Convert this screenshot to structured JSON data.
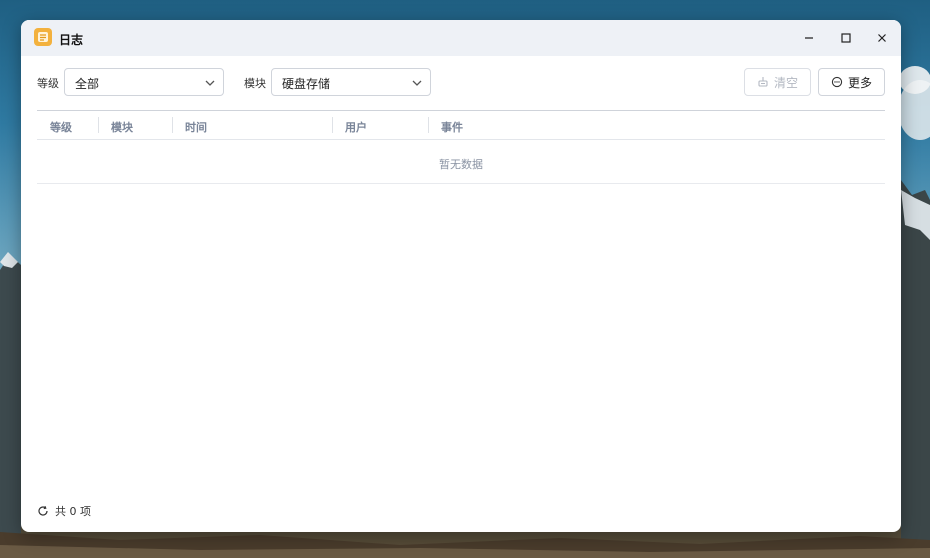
{
  "window": {
    "title": "日志",
    "controls": [
      "minimize-icon",
      "maximize-icon",
      "close-icon"
    ]
  },
  "filters": {
    "level_label": "等级",
    "level_value": "全部",
    "module_label": "模块",
    "module_value": "硬盘存储"
  },
  "actions": {
    "clear_label": "清空",
    "more_label": "更多"
  },
  "table": {
    "columns": [
      "等级",
      "模块",
      "时间",
      "用户",
      "事件"
    ],
    "empty_text": "暂无数据"
  },
  "footer": {
    "total_text": "共 0 项"
  },
  "colors": {
    "accent": "#f3b13d",
    "titlebar_bg": "#eef1f6",
    "header_text": "#7a8599"
  }
}
